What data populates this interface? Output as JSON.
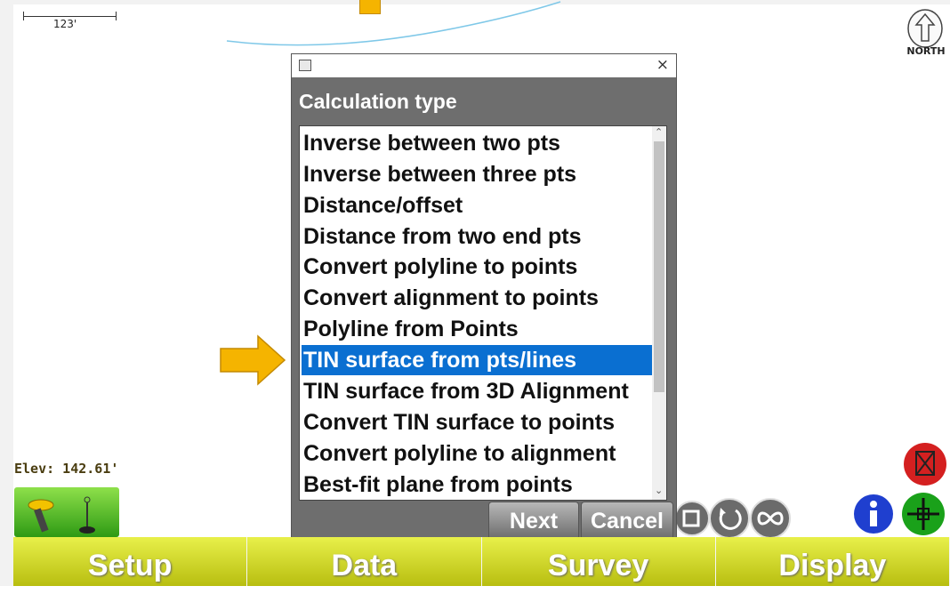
{
  "map": {
    "scale_label": "123'",
    "north_label": "NORTH",
    "elevation_label": "Elev: 142.61'"
  },
  "dialog": {
    "label": "Calculation type",
    "close_glyph": "×",
    "items": [
      "Inverse between two pts",
      "Inverse between three pts",
      "Distance/offset",
      "Distance from two end pts",
      "Convert polyline to points",
      "Convert alignment to points",
      "Polyline from Points",
      "TIN surface from pts/lines",
      "TIN surface from 3D Alignment",
      "Convert TIN surface to points",
      "Convert polyline to alignment",
      "Best-fit plane from points"
    ],
    "selected_index": 7,
    "next_label": "Next",
    "cancel_label": "Cancel"
  },
  "tabs": [
    "Setup",
    "Data",
    "Survey",
    "Display"
  ],
  "colors": {
    "selection": "#0a6fd1",
    "tab_bar": "#d6dc1e",
    "arrow": "#f5b400"
  }
}
